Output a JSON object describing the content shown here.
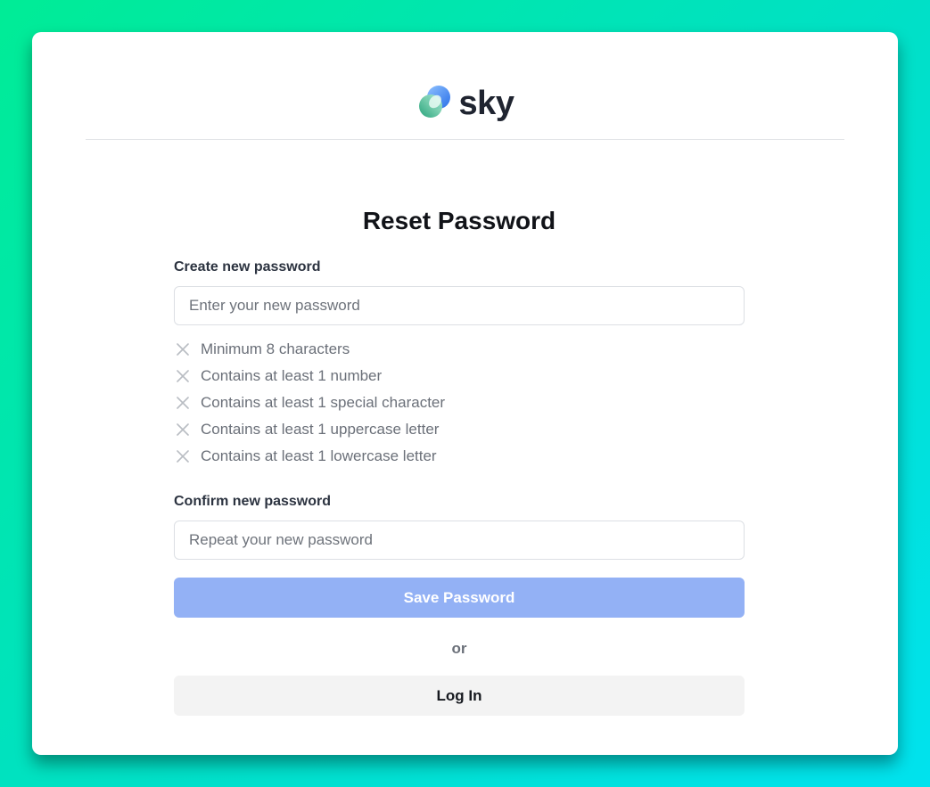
{
  "brand": {
    "name": "sky",
    "logo_icon": "sky-logo-icon"
  },
  "form": {
    "title": "Reset Password",
    "new_password": {
      "label": "Create new password",
      "placeholder": "Enter your new password",
      "value": ""
    },
    "requirements": [
      {
        "text": "Minimum 8 characters",
        "icon": "x-icon",
        "met": false
      },
      {
        "text": "Contains at least 1 number",
        "icon": "x-icon",
        "met": false
      },
      {
        "text": "Contains at least 1 special character",
        "icon": "x-icon",
        "met": false
      },
      {
        "text": "Contains at least 1 uppercase letter",
        "icon": "x-icon",
        "met": false
      },
      {
        "text": "Contains at least 1 lowercase letter",
        "icon": "x-icon",
        "met": false
      }
    ],
    "confirm_password": {
      "label": "Confirm new password",
      "placeholder": "Repeat your new password",
      "value": ""
    },
    "save_label": "Save Password",
    "or_text": "or",
    "login_label": "Log In"
  },
  "colors": {
    "background_start": "#00ec96",
    "background_end": "#00e2ee",
    "save_button": "#93b1f5",
    "login_button": "#f3f3f3",
    "requirement_text": "#6b7079"
  }
}
